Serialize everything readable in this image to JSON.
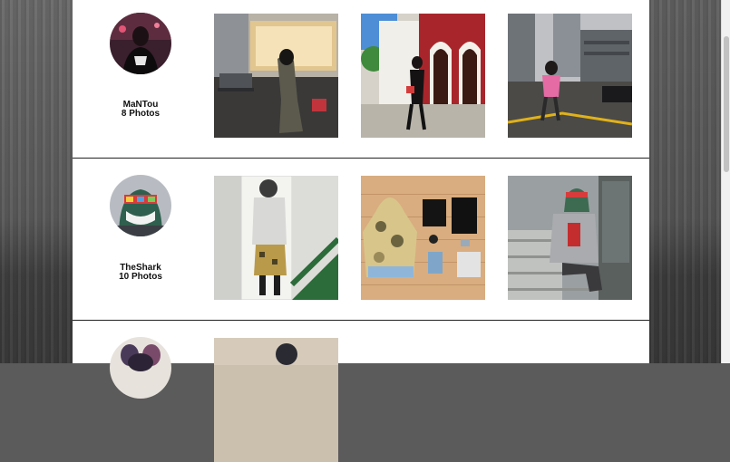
{
  "users": [
    {
      "name": "MaNTou",
      "photo_count": "8 Photos"
    },
    {
      "name": "TheShark",
      "photo_count": "10 Photos"
    },
    {
      "name": "",
      "photo_count": ""
    }
  ]
}
